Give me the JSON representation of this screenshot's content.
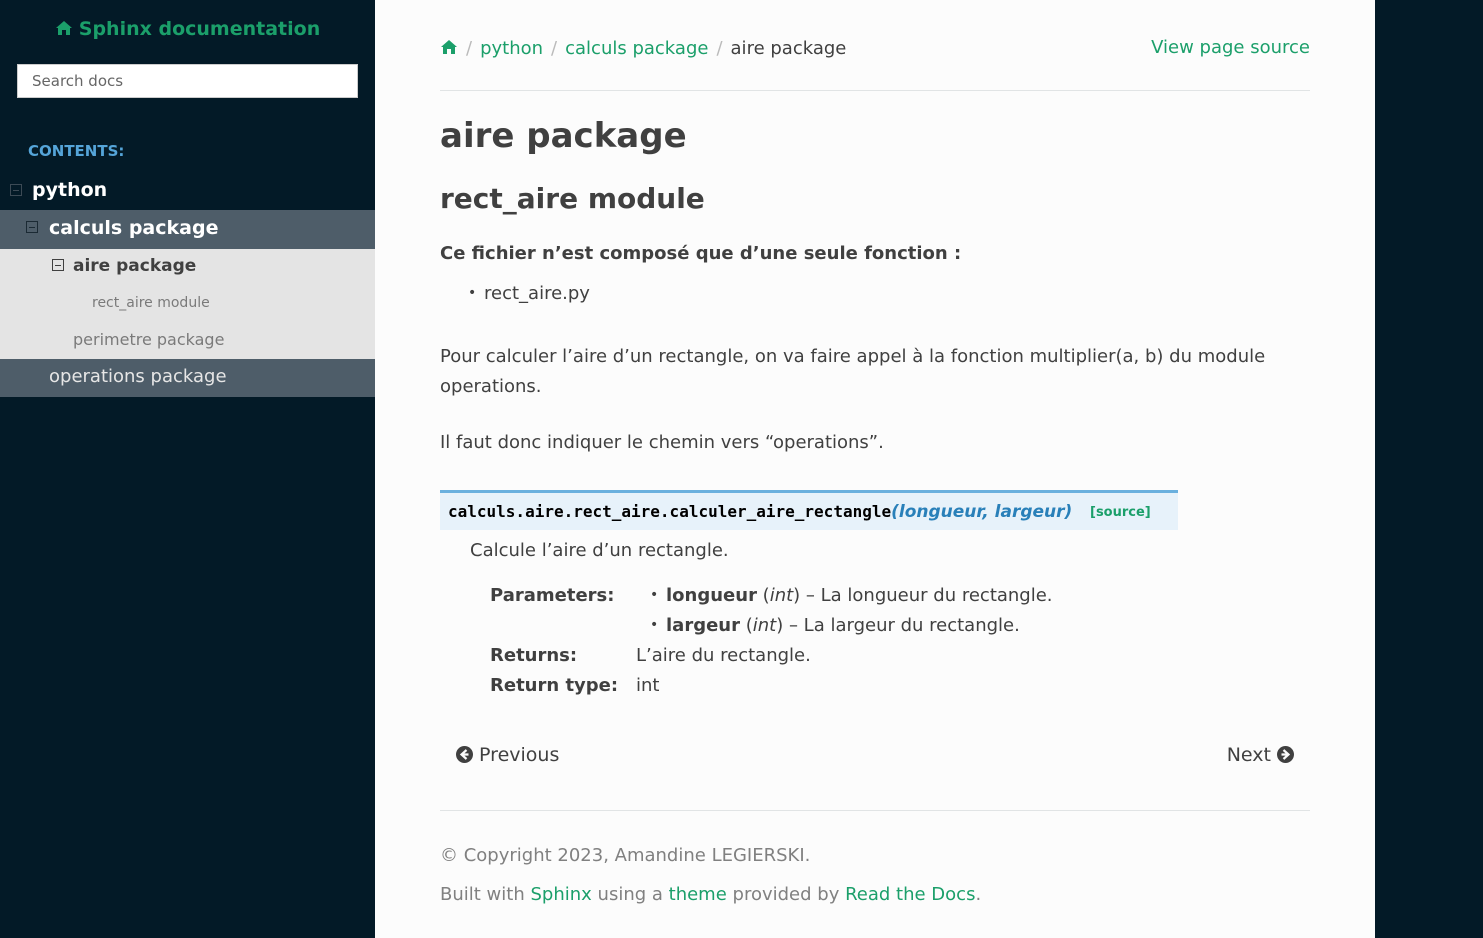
{
  "sidebar": {
    "brand": "Sphinx documentation",
    "search_placeholder": "Search docs",
    "caption": "CONTENTS:",
    "items": {
      "python": "python",
      "calculs": "calculs package",
      "aire": "aire package",
      "rect_aire": "rect_aire module",
      "perimetre": "perimetre package",
      "operations": "operations package"
    }
  },
  "breadcrumb": {
    "python": "python",
    "calculs": "calculs package",
    "current": "aire package",
    "separator": "/",
    "view_source": "View page source"
  },
  "main": {
    "title": "aire package",
    "module_title": "rect_aire module",
    "lead": "Ce fichier n’est composé que d’une seule fonction :",
    "file": "rect_aire.py",
    "para1": "Pour calculer l’aire d’un rectangle, on va faire appel à la fonction multiplier(a, b) du module operations.",
    "para2": "Il faut donc indiquer le chemin vers “operations”.",
    "signature": {
      "name": "calculs.aire.rect_aire.calculer_aire_rectangle",
      "params": "(longueur, largeur)",
      "source": "[source]"
    },
    "description": "Calcule l’aire d’un rectangle.",
    "fields": {
      "parameters_label": "Parameters:",
      "p1_name": "longueur",
      "p1_type": "int",
      "p1_desc": "La longueur du rectangle.",
      "p2_name": "largeur",
      "p2_type": "int",
      "p2_desc": "La largeur du rectangle.",
      "returns_label": "Returns:",
      "returns": "L’aire du rectangle.",
      "rtype_label": "Return type:",
      "rtype": "int"
    }
  },
  "nav": {
    "previous": "Previous",
    "next": "Next"
  },
  "footer": {
    "copyright": "© Copyright 2023, Amandine LEGIERSKI.",
    "built_prefix": "Built with",
    "sphinx": "Sphinx",
    "using": "using a",
    "theme": "theme",
    "provided": "provided by",
    "rtd": "Read the Docs",
    "period": "."
  },
  "colors": {
    "accent": "#1b9f6a",
    "sidebar_bg": "#031a27",
    "caption": "#55a5d9",
    "sig_bg": "#e7f2fa",
    "sig_border": "#6ab0de"
  }
}
